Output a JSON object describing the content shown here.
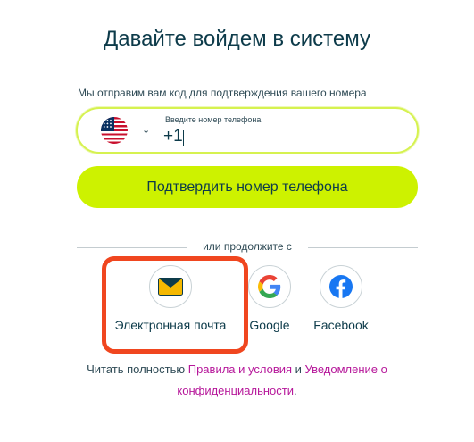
{
  "page": {
    "title": "Давайте войдем в систему",
    "hint": "Мы отправим вам код для подтверждения вашего номера"
  },
  "phone": {
    "country_flag": "us-flag-icon",
    "field_label": "Введите номер телефона",
    "value": "+1"
  },
  "confirm_label": "Подтвердить номер телефона",
  "divider_text": "или продолжите с",
  "social": [
    {
      "label": "Электронная почта",
      "icon": "envelope-icon"
    },
    {
      "label": "Google",
      "icon": "google-icon"
    },
    {
      "label": "Facebook",
      "icon": "facebook-icon"
    }
  ],
  "footer": {
    "prefix": "Читать полностью",
    "terms_link": "Правила и условия",
    "and": "и",
    "privacy_link": "Уведомление о конфиденциальности",
    "suffix": "."
  },
  "colors": {
    "accent": "#cdf200",
    "accent_border": "#d6f250",
    "text_dark": "#0d3b4a",
    "link": "#b6179a",
    "highlight": "#f0461f"
  }
}
